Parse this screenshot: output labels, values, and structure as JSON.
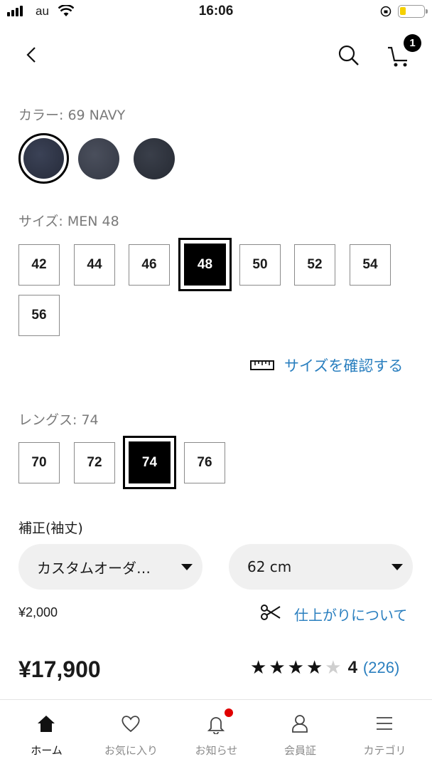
{
  "status_bar": {
    "carrier": "au",
    "time": "16:06"
  },
  "header": {
    "cart_count": "1"
  },
  "color_section": {
    "label": "カラー: 69 NAVY",
    "swatches": [
      {
        "name": "navy-selected",
        "color": "#2e3446"
      },
      {
        "name": "navy-2",
        "color": "#3c414d"
      },
      {
        "name": "navy-3",
        "color": "#2d313a"
      }
    ]
  },
  "size_section": {
    "label": "サイズ: MEN 48",
    "sizes": [
      "42",
      "44",
      "46",
      "48",
      "50",
      "52",
      "54",
      "56"
    ],
    "selected": "48",
    "size_check_link": "サイズを確認する"
  },
  "length_section": {
    "label": "レングス: 74",
    "lengths": [
      "70",
      "72",
      "74",
      "76"
    ],
    "selected": "74"
  },
  "alteration": {
    "label": "補正(袖丈)",
    "type_select": "カスタムオーダ…",
    "length_select": "62 cm",
    "fee": "¥2,000",
    "finish_link": "仕上がりについて"
  },
  "price": "¥17,900",
  "rating": {
    "score": "4",
    "stars": 4,
    "max_stars": 5,
    "count": "(226)"
  },
  "tabs": [
    {
      "label": "ホーム",
      "icon": "home-icon",
      "active": true
    },
    {
      "label": "お気に入り",
      "icon": "heart-icon",
      "active": false
    },
    {
      "label": "お知らせ",
      "icon": "bell-icon",
      "active": false
    },
    {
      "label": "会員証",
      "icon": "person-icon",
      "active": false
    },
    {
      "label": "カテゴリ",
      "icon": "menu-icon",
      "active": false
    }
  ],
  "colors": {
    "accent_link": "#2a7fbf",
    "notification_dot": "#e00000"
  }
}
